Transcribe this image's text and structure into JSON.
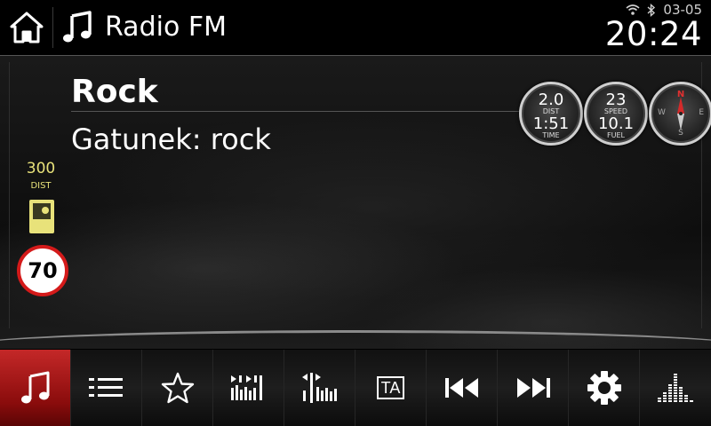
{
  "header": {
    "app_title": "Radio FM",
    "date": "03-05",
    "time": "20:24",
    "icons": [
      "home-icon",
      "music-note-icon",
      "wifi-icon",
      "bluetooth-icon"
    ]
  },
  "station": {
    "name": "Rock",
    "genre": "Gatunek: rock"
  },
  "gauges": [
    {
      "top_value": "2.0",
      "top_label": "DIST",
      "bottom_value": "1:51",
      "bottom_label": "TIME"
    },
    {
      "top_value": "23",
      "top_label": "SPEED",
      "bottom_value": "10.1",
      "bottom_label": "FUEL"
    }
  ],
  "compass": {
    "n": "N",
    "s": "S",
    "e": "E",
    "w": "W"
  },
  "speed_camera": {
    "distance": "300",
    "distance_label": "DIST",
    "speed_limit": "70"
  },
  "toolbar": {
    "buttons": [
      {
        "name": "music",
        "icon": "music-note-icon",
        "active": true
      },
      {
        "name": "station-list",
        "icon": "list-icon",
        "active": false
      },
      {
        "name": "favorites",
        "icon": "star-icon",
        "active": false
      },
      {
        "name": "scan",
        "icon": "scan-icon",
        "active": false
      },
      {
        "name": "tune",
        "icon": "tune-icon",
        "active": false
      },
      {
        "name": "traffic-announcement",
        "icon": "ta-icon",
        "label": "TA",
        "active": false
      },
      {
        "name": "previous",
        "icon": "previous-icon",
        "active": false
      },
      {
        "name": "next",
        "icon": "next-icon",
        "active": false
      },
      {
        "name": "settings",
        "icon": "gear-icon",
        "active": false
      },
      {
        "name": "equalizer",
        "icon": "equalizer-icon",
        "active": false
      }
    ]
  },
  "colors": {
    "active": "#c42828",
    "camera_yellow": "#e8e27a",
    "limit_red": "#d41a1a"
  }
}
